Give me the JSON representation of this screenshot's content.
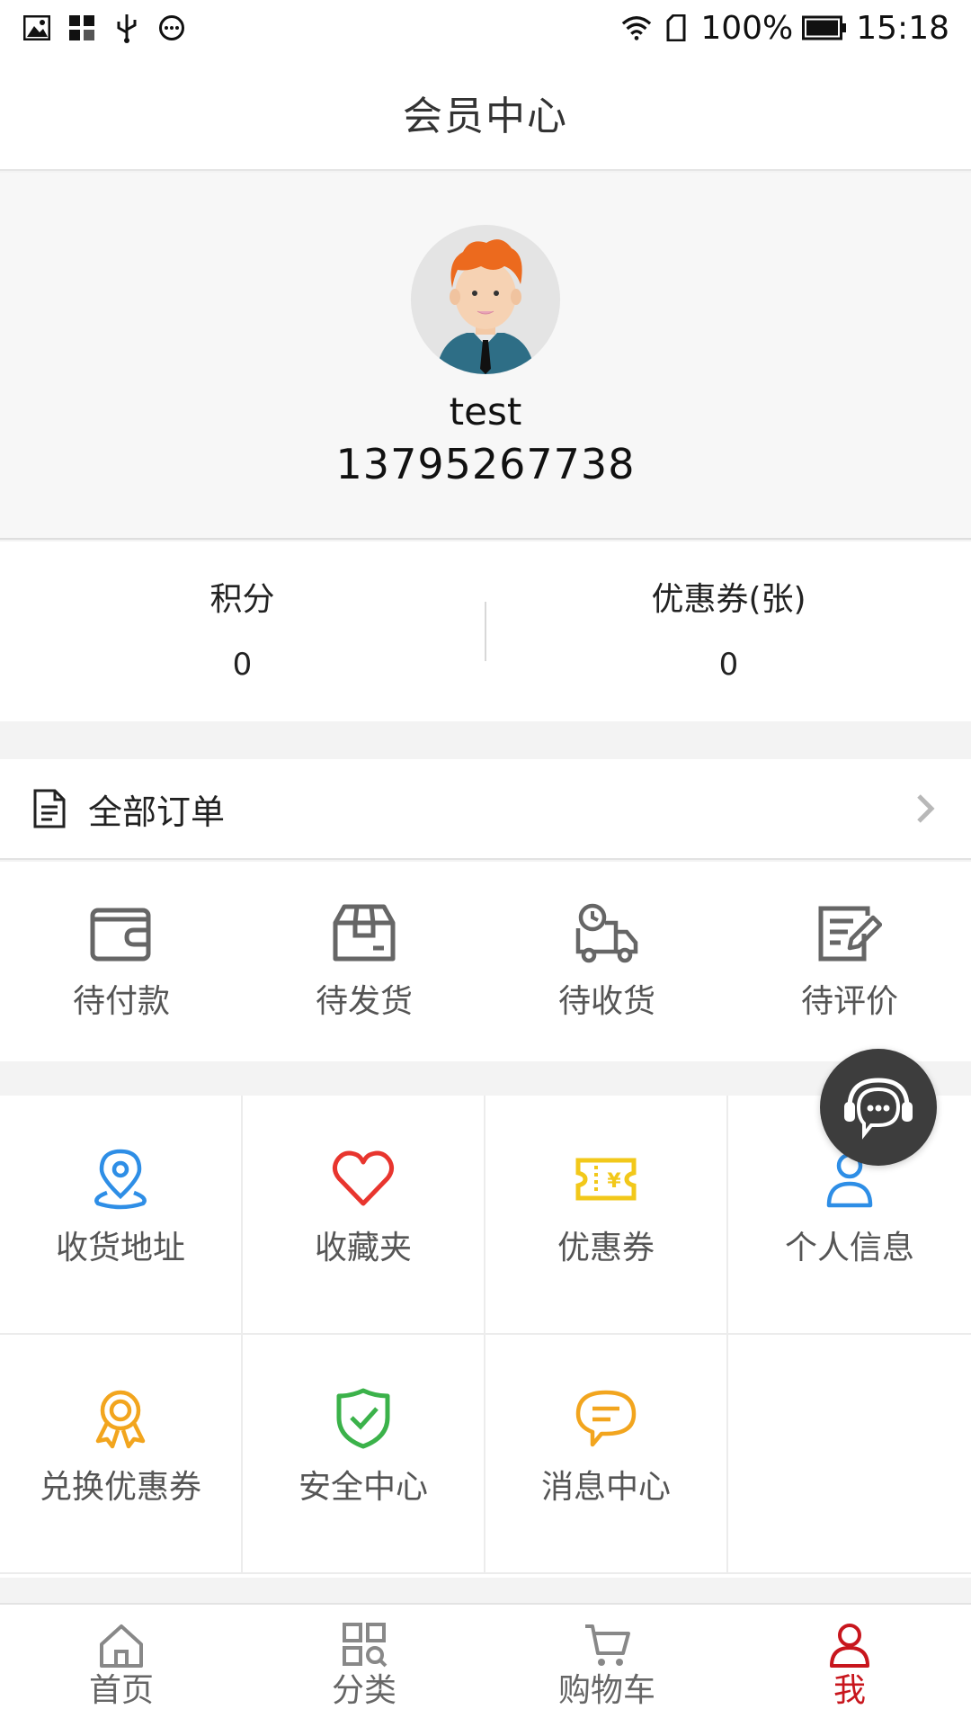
{
  "status_bar": {
    "icons_left": [
      "image-icon",
      "apps-icon",
      "usb-icon",
      "more-icon"
    ],
    "icons_right": [
      "wifi-icon",
      "sim-icon"
    ],
    "battery": "100%",
    "time": "15:18"
  },
  "header": {
    "title": "会员中心"
  },
  "profile": {
    "avatar_icon": "user-avatar",
    "username": "test",
    "phone": "13795267738"
  },
  "stats": [
    {
      "label": "积分",
      "value": "0"
    },
    {
      "label": "优惠券(张)",
      "value": "0"
    }
  ],
  "orders": {
    "label": "全部订单",
    "icon": "document-icon",
    "status": [
      {
        "label": "待付款",
        "icon": "wallet-icon"
      },
      {
        "label": "待发货",
        "icon": "package-icon"
      },
      {
        "label": "待收货",
        "icon": "truck-icon"
      },
      {
        "label": "待评价",
        "icon": "edit-icon"
      }
    ]
  },
  "services": [
    {
      "label": "收货地址",
      "icon": "location-icon",
      "color": "#2e8ee6"
    },
    {
      "label": "收藏夹",
      "icon": "heart-icon",
      "color": "#e8352e"
    },
    {
      "label": "优惠券",
      "icon": "ticket-icon",
      "color": "#f2c81a"
    },
    {
      "label": "个人信息",
      "icon": "person-icon",
      "color": "#2e8ee6"
    },
    {
      "label": "兑换优惠券",
      "icon": "award-icon",
      "color": "#f2a51e"
    },
    {
      "label": "安全中心",
      "icon": "shield-icon",
      "color": "#3bb24a"
    },
    {
      "label": "消息中心",
      "icon": "chat-icon",
      "color": "#f2a51e"
    }
  ],
  "nav": [
    {
      "label": "首页",
      "icon": "home-icon"
    },
    {
      "label": "分类",
      "icon": "category-icon"
    },
    {
      "label": "购物车",
      "icon": "cart-icon"
    },
    {
      "label": "我",
      "icon": "user-icon",
      "active": true
    }
  ],
  "colors": {
    "accent": "#c8161d",
    "float_button": "#3d3d3d"
  }
}
